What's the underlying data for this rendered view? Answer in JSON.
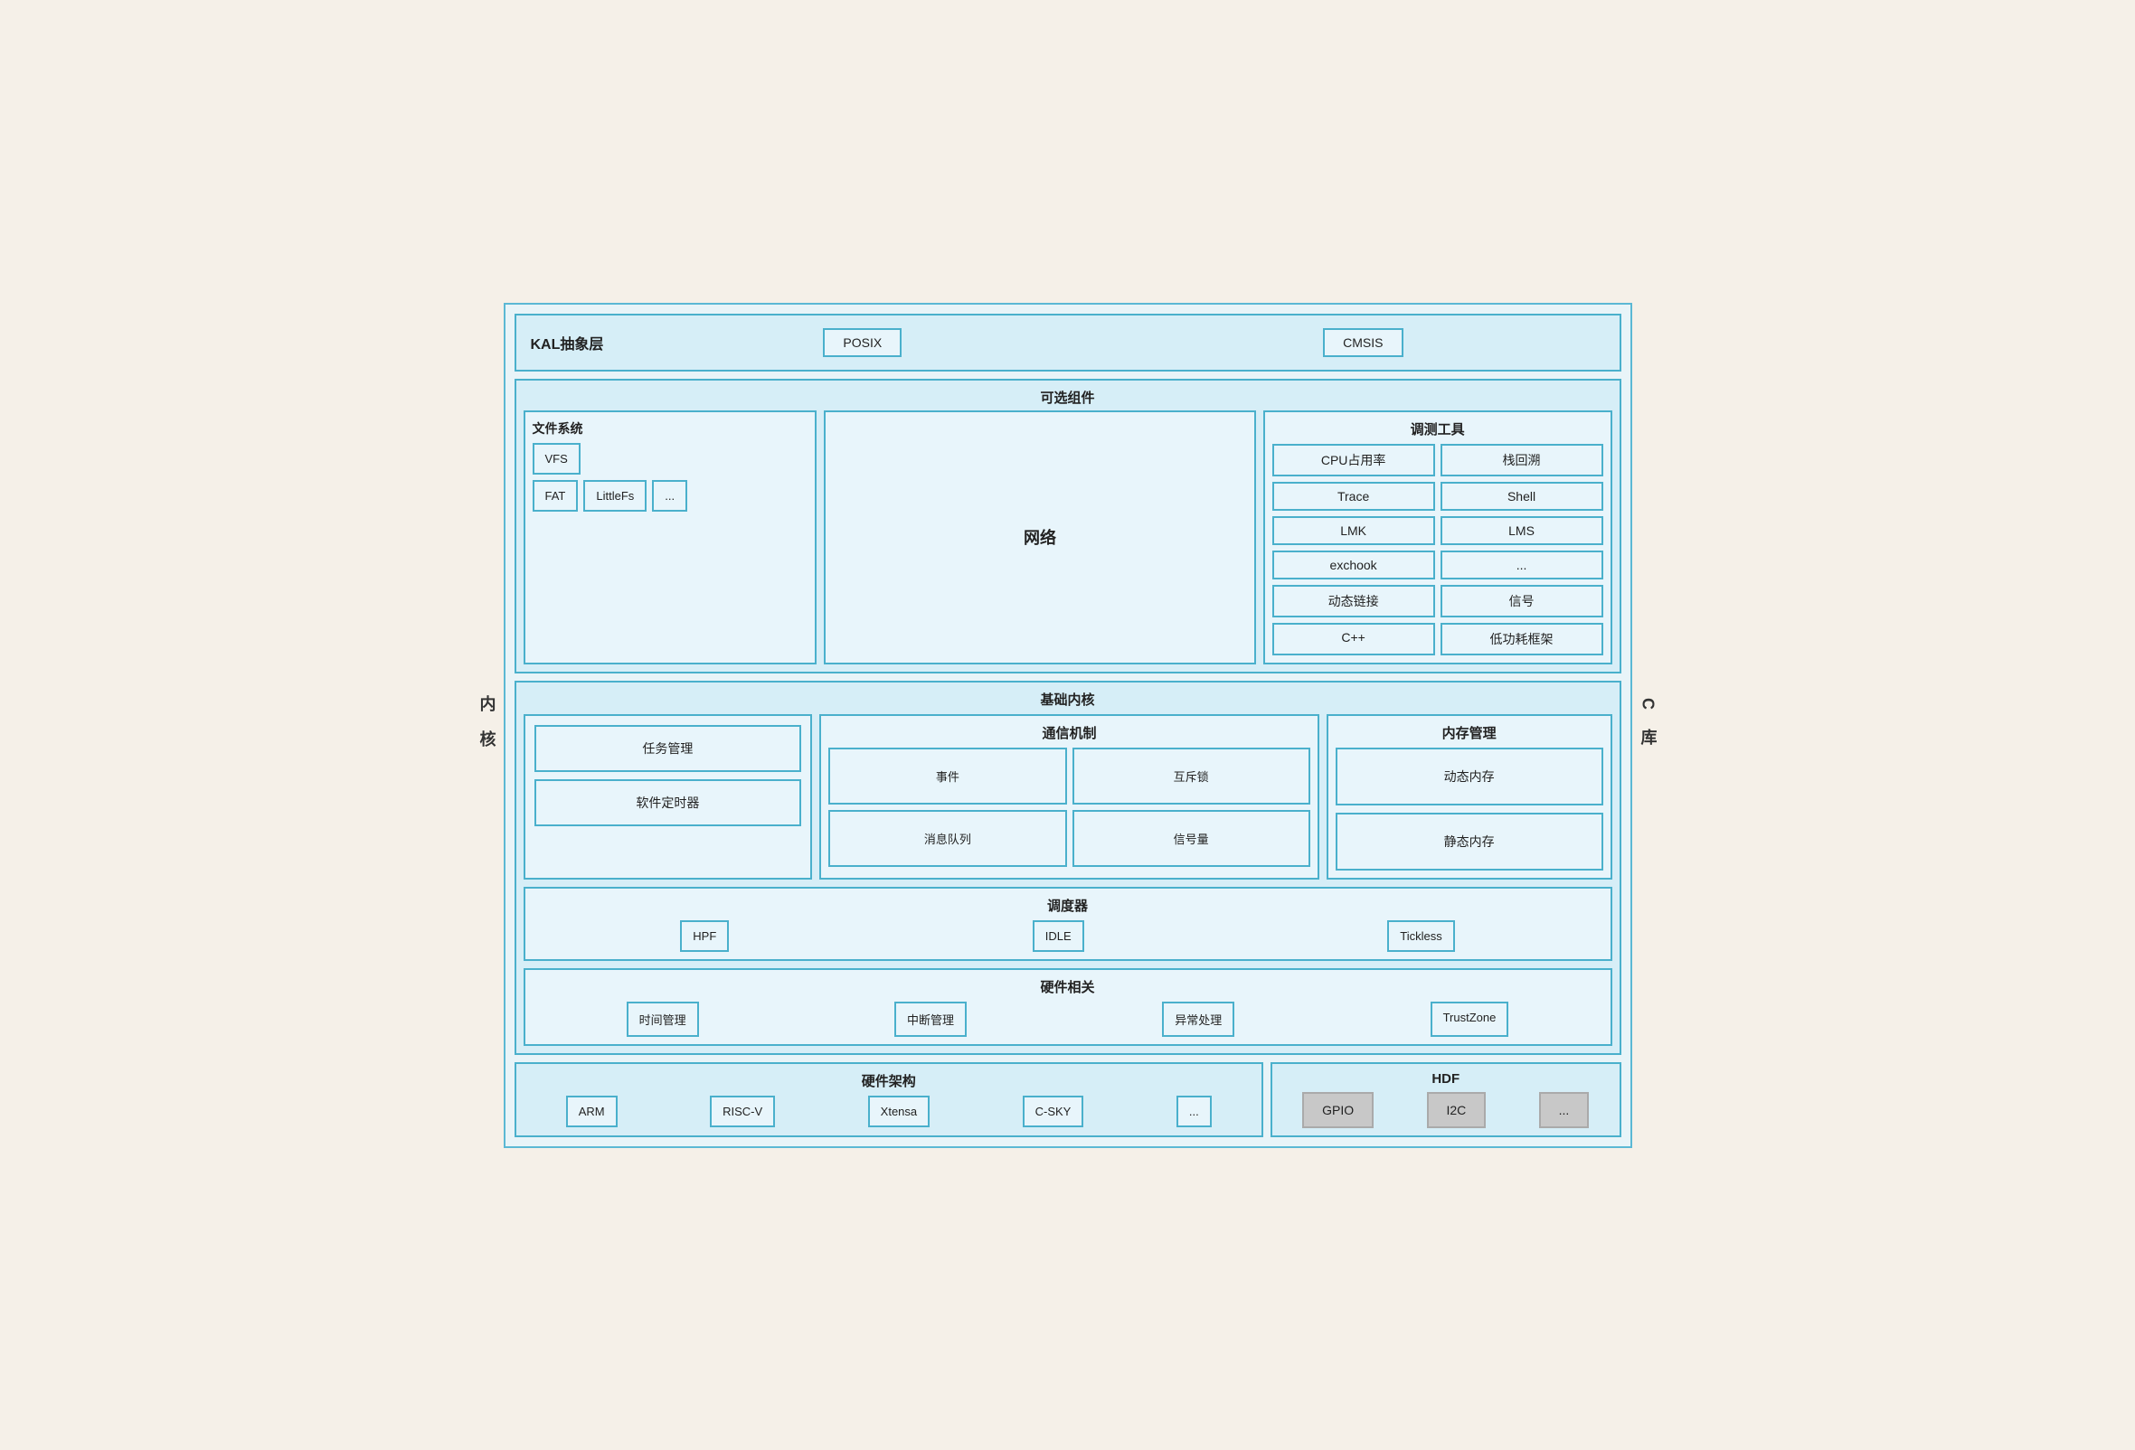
{
  "left_label": "内\n核",
  "right_label": "C\n库",
  "kal": {
    "label": "KAL抽象层",
    "items": [
      "POSIX",
      "CMSIS"
    ]
  },
  "optional": {
    "title": "可选组件",
    "filesys": {
      "label": "文件系统",
      "items": [
        "VFS",
        "FAT",
        "LittleFs",
        "..."
      ]
    },
    "network": {
      "label": "网络"
    },
    "debug": {
      "label": "调测工具",
      "items": [
        "CPU占用率",
        "栈回溯",
        "Trace",
        "Shell",
        "LMK",
        "LMS",
        "exchook",
        "...",
        "动态链接",
        "信号",
        "C++",
        "低功耗框架"
      ]
    }
  },
  "kernel": {
    "title": "基础内核",
    "task": "任务管理",
    "timer": "软件定时器",
    "comm": {
      "title": "通信机制",
      "items": [
        "事件",
        "互斥锁",
        "消息队列",
        "信号量"
      ]
    },
    "mem": {
      "title": "内存管理",
      "dynamic": "动态内存",
      "static": "静态内存"
    },
    "scheduler": {
      "title": "调度器",
      "items": [
        "HPF",
        "IDLE",
        "Tickless"
      ]
    },
    "hardware": {
      "title": "硬件相关",
      "items": [
        "时间管理",
        "中断管理",
        "异常处理",
        "TrustZone"
      ]
    }
  },
  "hw_arch": {
    "title": "硬件架构",
    "items": [
      "ARM",
      "RISC-V",
      "Xtensa",
      "C-SKY",
      "..."
    ]
  },
  "hdf": {
    "title": "HDF",
    "items": [
      "GPIO",
      "I2C",
      "..."
    ]
  }
}
